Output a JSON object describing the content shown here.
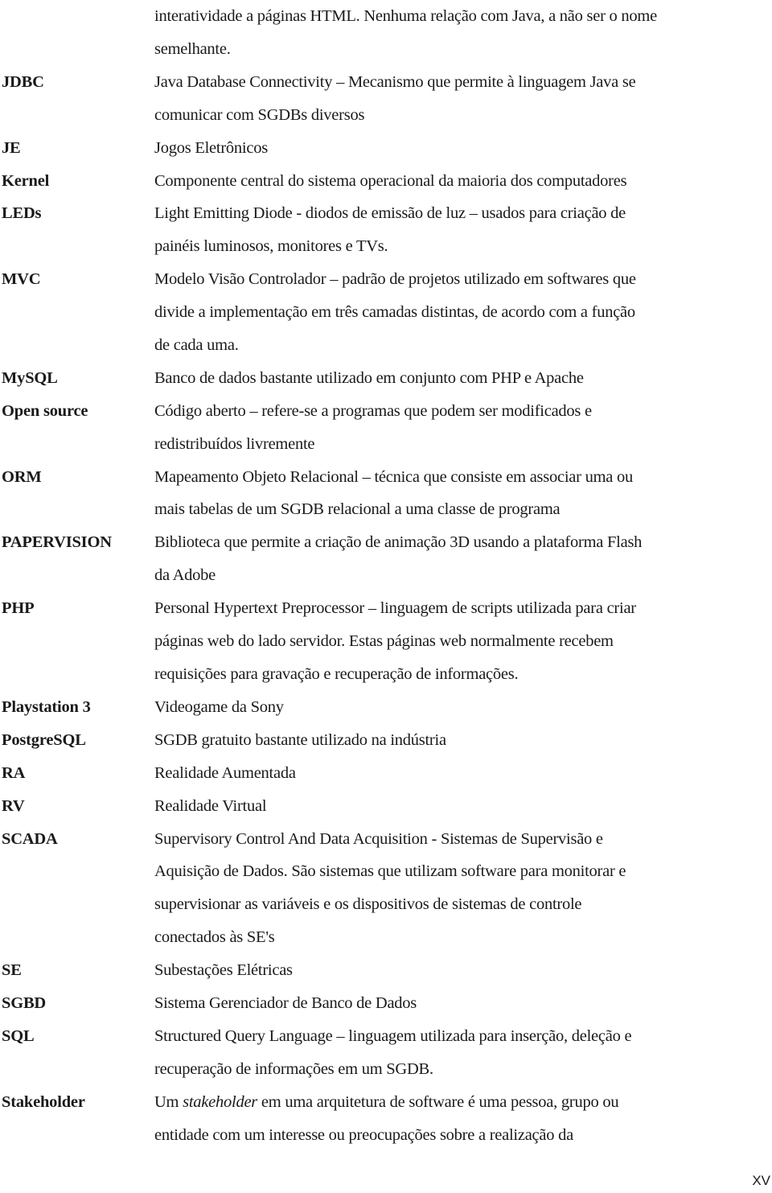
{
  "document": {
    "page_number": "XV",
    "continuation_lines": [
      "interatividade a páginas HTML. Nenhuma relação com Java, a não ser o nome",
      "semelhante."
    ],
    "glossary": [
      {
        "term": "JDBC",
        "lines": [
          "Java Database Connectivity – Mecanismo que permite à linguagem Java se",
          "comunicar com SGDBs diversos"
        ]
      },
      {
        "term": "JE",
        "lines": [
          "Jogos Eletrônicos"
        ]
      },
      {
        "term": "Kernel",
        "lines": [
          "Componente central do sistema operacional da maioria dos computadores"
        ]
      },
      {
        "term": "LEDs",
        "lines": [
          "Light Emitting Diode - diodos de emissão de luz – usados para criação de",
          "painéis luminosos, monitores e TVs."
        ]
      },
      {
        "term": "MVC",
        "lines": [
          "Modelo Visão Controlador – padrão de projetos utilizado em softwares que",
          "divide a implementação em três camadas distintas, de acordo com a função",
          "de cada uma."
        ]
      },
      {
        "term": "MySQL",
        "lines": [
          "Banco de dados bastante utilizado em conjunto com PHP e Apache"
        ]
      },
      {
        "term": "Open source",
        "lines": [
          "Código aberto – refere-se a programas que podem ser modificados e",
          "redistribuídos livremente"
        ]
      },
      {
        "term": "ORM",
        "lines": [
          "Mapeamento Objeto Relacional – técnica que consiste em associar uma ou",
          "mais tabelas de um SGDB relacional a uma classe de programa"
        ]
      },
      {
        "term": "PAPERVISION",
        "lines": [
          "Biblioteca que permite a criação de animação 3D usando a plataforma Flash",
          "da Adobe"
        ]
      },
      {
        "term": "PHP",
        "lines": [
          "Personal Hypertext Preprocessor – linguagem de scripts utilizada para criar",
          "páginas web do lado servidor. Estas páginas web normalmente recebem",
          "requisições para gravação e recuperação de informações."
        ]
      },
      {
        "term": "Playstation 3",
        "lines": [
          "Videogame da Sony"
        ]
      },
      {
        "term": "PostgreSQL",
        "lines": [
          "SGDB gratuito bastante utilizado na indústria"
        ]
      },
      {
        "term": "RA",
        "lines": [
          "Realidade Aumentada"
        ]
      },
      {
        "term": "RV",
        "lines": [
          "Realidade Virtual"
        ]
      },
      {
        "term": "SCADA",
        "lines": [
          "Supervisory Control And Data Acquisition - Sistemas de Supervisão e",
          "Aquisição de Dados. São sistemas que utilizam software para monitorar e",
          "supervisionar as variáveis e os dispositivos de sistemas de controle",
          "conectados às SE's"
        ]
      },
      {
        "term": "SE",
        "lines": [
          "Subestações Elétricas"
        ]
      },
      {
        "term": "SGBD",
        "lines": [
          "Sistema Gerenciador de Banco de Dados"
        ]
      },
      {
        "term": "SQL",
        "lines": [
          "Structured Query Language – linguagem utilizada para inserção, deleção e",
          "recuperação de informações em um SGDB."
        ]
      },
      {
        "term": "Stakeholder",
        "lines_rich": [
          [
            {
              "text": "Um "
            },
            {
              "text": "stakeholder",
              "italic": true
            },
            {
              "text": " em uma arquitetura de software é uma pessoa, grupo ou"
            }
          ],
          [
            {
              "text": "entidade com um interesse ou preocupações sobre a realização da"
            }
          ]
        ]
      }
    ]
  }
}
